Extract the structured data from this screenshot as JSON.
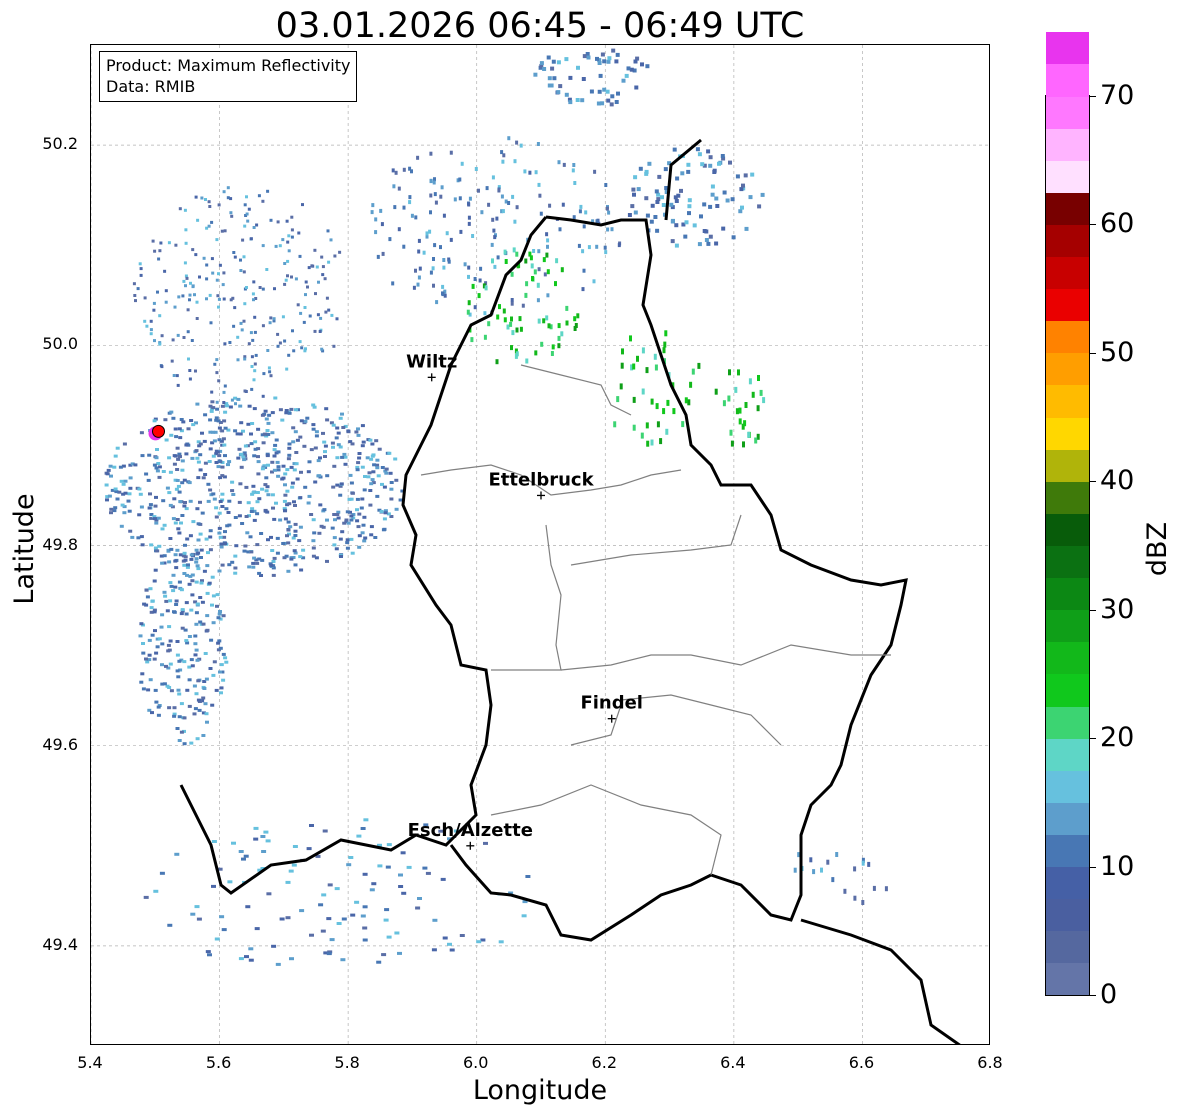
{
  "title": "03.01.2026 06:45 - 06:49 UTC",
  "info_box": {
    "product_line": "Product: Maximum Reflectivity",
    "data_line": "Data: RMIB"
  },
  "axes": {
    "xlabel": "Longitude",
    "ylabel": "Latitude",
    "xlim": [
      5.4,
      6.8
    ],
    "ylim": [
      49.3,
      50.3
    ],
    "xticks": [
      "5.4",
      "5.6",
      "5.8",
      "6.0",
      "6.2",
      "6.4",
      "6.6",
      "6.8"
    ],
    "yticks": [
      "49.4",
      "49.6",
      "49.8",
      "50.0",
      "50.2"
    ],
    "grid": true
  },
  "colorbar": {
    "title": "dBZ",
    "ticks": [
      "0",
      "10",
      "20",
      "30",
      "40",
      "50",
      "60",
      "70"
    ],
    "range": [
      0,
      70
    ],
    "step": 2.5,
    "colors": [
      "#6475a8",
      "#55689f",
      "#4a5fa0",
      "#4560a6",
      "#4877b4",
      "#5d9ecc",
      "#66c1de",
      "#5ed6c6",
      "#3cd472",
      "#10c81c",
      "#12b81a",
      "#0f9f18",
      "#0c8814",
      "#0b7112",
      "#085c0a",
      "#3f7a0a",
      "#b0b40a",
      "#ffd700",
      "#ffbb00",
      "#ff9e00",
      "#ff8200",
      "#ea0000",
      "#c80000",
      "#a50000",
      "#780000",
      "#ffe0ff",
      "#ffb4ff",
      "#ff78ff",
      "#ff66ff",
      "#e834ee"
    ]
  },
  "cities": [
    {
      "name": "Wiltz",
      "lon": 5.93,
      "lat": 49.968
    },
    {
      "name": "Ettelbruck",
      "lon": 6.1,
      "lat": 49.85
    },
    {
      "name": "Findel",
      "lon": 6.21,
      "lat": 49.627
    },
    {
      "name": "Esch/Alzette",
      "lon": 5.99,
      "lat": 49.5
    }
  ],
  "radar_site": {
    "lon": 5.505,
    "lat": 49.914,
    "color": "#ff0000"
  },
  "colors": {
    "border": "#000000",
    "canton_border": "#808080",
    "grid": "#b0b0b0"
  }
}
